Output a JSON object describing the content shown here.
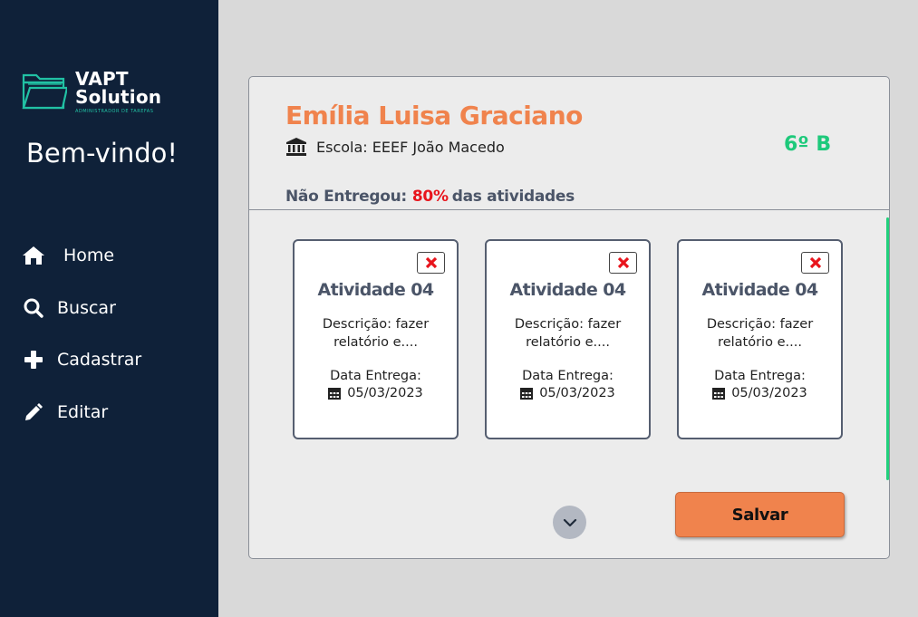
{
  "brand": {
    "line1": "VAPT",
    "line2": "Solution",
    "tagline": "ADMINISTRADOR DE TAREFAS",
    "accent_color": "#21c1a4"
  },
  "sidebar": {
    "welcome": "Bem-vindo!",
    "items": [
      {
        "label": "Home",
        "icon": "home-icon"
      },
      {
        "label": "Buscar",
        "icon": "search-icon"
      },
      {
        "label": "Cadastrar",
        "icon": "plus-icon"
      },
      {
        "label": "Editar",
        "icon": "pencil-icon"
      }
    ]
  },
  "student": {
    "name": "Emília Luisa Graciano",
    "school": "Escola: EEEF João Macedo",
    "class": "6º B"
  },
  "status": {
    "prefix": "Não Entregou:",
    "percent": "80%",
    "suffix": "das atividades"
  },
  "activities": [
    {
      "title": "Atividade 04",
      "description": "Descrição: fazer relatório e....",
      "date_label": "Data Entrega:",
      "date": "05/03/2023"
    },
    {
      "title": "Atividade 04",
      "description": "Descrição: fazer relatório e....",
      "date_label": "Data Entrega:",
      "date": "05/03/2023"
    },
    {
      "title": "Atividade 04",
      "description": "Descrição: fazer relatório e....",
      "date_label": "Data Entrega:",
      "date": "05/03/2023"
    }
  ],
  "actions": {
    "save_label": "Salvar"
  },
  "colors": {
    "sidebar_bg": "#0f2139",
    "name_color": "#f0834d",
    "class_color": "#1ec97b",
    "percent_color": "#e8141c",
    "save_bg": "#f0834d"
  }
}
